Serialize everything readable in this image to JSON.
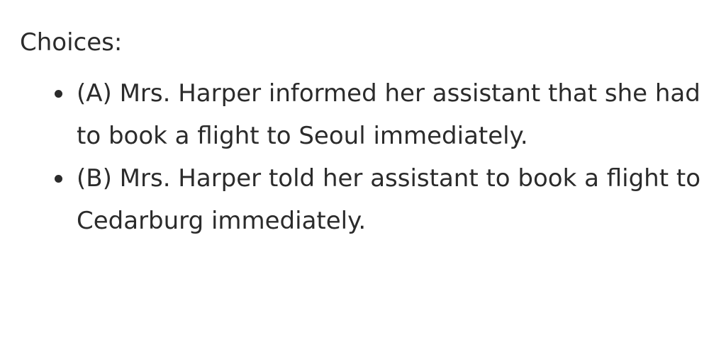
{
  "heading": "Choices:",
  "choices": [
    {
      "text": "(A) Mrs. Harper informed her assistant that she had to book a flight to Seoul immediately."
    },
    {
      "text": "(B) Mrs. Harper told her assistant to book a flight to Cedarburg immediately."
    }
  ]
}
